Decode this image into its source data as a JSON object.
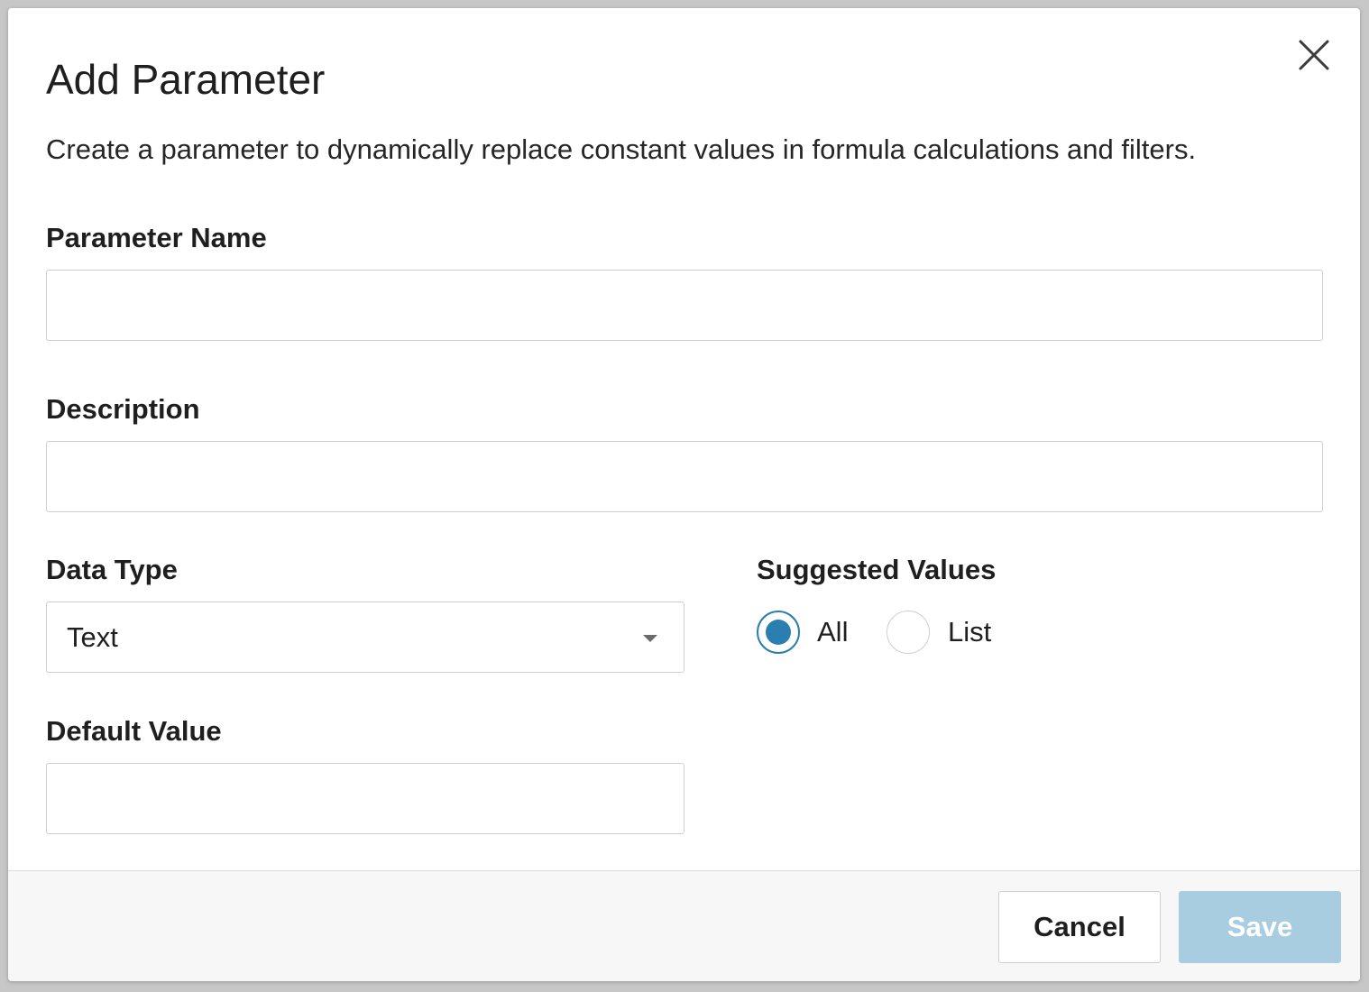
{
  "dialog": {
    "title": "Add Parameter",
    "description": "Create a parameter to dynamically replace constant values in formula calculations and filters.",
    "close_icon": "close-icon"
  },
  "fields": {
    "parameter_name": {
      "label": "Parameter Name",
      "value": "",
      "placeholder": ""
    },
    "description": {
      "label": "Description",
      "value": "",
      "placeholder": ""
    },
    "data_type": {
      "label": "Data Type",
      "selected": "Text",
      "caret_icon": "chevron-down-icon"
    },
    "default_value": {
      "label": "Default Value",
      "value": "",
      "placeholder": ""
    },
    "suggested_values": {
      "label": "Suggested Values",
      "options": [
        {
          "label": "All",
          "checked": true
        },
        {
          "label": "List",
          "checked": false
        }
      ]
    }
  },
  "footer": {
    "cancel_label": "Cancel",
    "save_label": "Save",
    "save_enabled": false
  },
  "colors": {
    "accent": "#2b7fb0",
    "save_disabled_bg": "#a9cde0",
    "footer_bg": "#f7f7f7",
    "border": "#cfcfcf"
  }
}
